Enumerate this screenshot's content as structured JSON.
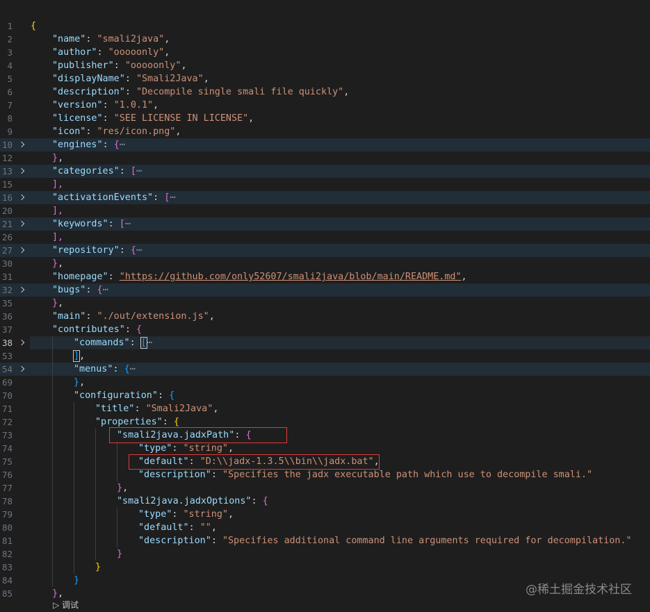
{
  "editor": {
    "line_numbers": [
      "1",
      "2",
      "3",
      "4",
      "5",
      "6",
      "7",
      "8",
      "9",
      "10",
      "12",
      "13",
      "15",
      "16",
      "20",
      "21",
      "26",
      "27",
      "30",
      "31",
      "32",
      "35",
      "36",
      "37",
      "38",
      "53",
      "54",
      "69",
      "70",
      "71",
      "72",
      "73",
      "74",
      "75",
      "76",
      "77",
      "78",
      "79",
      "80",
      "81",
      "82",
      "83",
      "84",
      "85"
    ],
    "fields": {
      "name_key": "\"name\"",
      "name_val": "\"smali2java\"",
      "author_key": "\"author\"",
      "author_val": "\"ooooonly\"",
      "publisher_key": "\"publisher\"",
      "publisher_val": "\"ooooonly\"",
      "displayName_key": "\"displayName\"",
      "displayName_val": "\"Smali2Java\"",
      "description_key": "\"description\"",
      "description_val": "\"Decompile single smali file quickly\"",
      "version_key": "\"version\"",
      "version_val": "\"1.0.1\"",
      "license_key": "\"license\"",
      "license_val": "\"SEE LICENSE IN LICENSE\"",
      "icon_key": "\"icon\"",
      "icon_val": "\"res/icon.png\"",
      "engines_key": "\"engines\"",
      "categories_key": "\"categories\"",
      "activationEvents_key": "\"activationEvents\"",
      "keywords_key": "\"keywords\"",
      "repository_key": "\"repository\"",
      "homepage_key": "\"homepage\"",
      "homepage_val": "\"https://github.com/only52607/smali2java/blob/main/README.md\"",
      "bugs_key": "\"bugs\"",
      "main_key": "\"main\"",
      "main_val": "\"./out/extension.js\"",
      "contributes_key": "\"contributes\"",
      "commands_key": "\"commands\"",
      "menus_key": "\"menus\"",
      "configuration_key": "\"configuration\"",
      "title_key": "\"title\"",
      "title_val": "\"Smali2Java\"",
      "properties_key": "\"properties\"",
      "jadxPath_key": "\"smali2java.jadxPath\"",
      "type_key": "\"type\"",
      "type_val": "\"string\"",
      "default_key": "\"default\"",
      "default_val": "\"D:\\\\jadx-1.3.5\\\\bin\\\\jadx.bat\"",
      "desc_key": "\"description\"",
      "desc1_val": "\"Specifies the jadx executable path which use to decompile smali.\"",
      "jadxOptions_key": "\"smali2java.jadxOptions\"",
      "default2_val": "\"\"",
      "desc2_val": "\"Specifies additional command line arguments required for decompilation.\""
    },
    "ellipsis": "⋯"
  },
  "debug_label": "调试",
  "watermark": "@稀土掘金技术社区",
  "colors": {
    "background": "#1e1e1e",
    "key": "#9cdcfe",
    "string": "#ce9178",
    "highlight_box": "#e03a3a"
  }
}
